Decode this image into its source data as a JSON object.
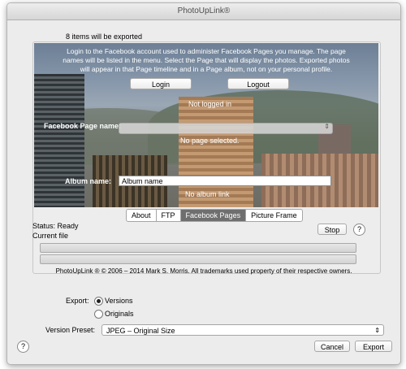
{
  "window": {
    "title": "PhotoUpLink®"
  },
  "export_info": {
    "items_count": "8 items will be exported"
  },
  "facebook": {
    "instructions": "Login to the Facebook account used to administer Facebook Pages you manage. The page names will be listed in the menu. Select the Page that will display the photos. Exported photos will appear in that Page timeline and in a Page album, not on your personal profile.",
    "login_label": "Login",
    "logout_label": "Logout",
    "login_status": "Not logged in",
    "page_label": "Facebook Page name:",
    "page_status": "No page selected.",
    "album_label": "Album name:",
    "album_value": "Album name",
    "album_link": "No album link"
  },
  "tabs": [
    {
      "label": "About"
    },
    {
      "label": "FTP"
    },
    {
      "label": "Facebook Pages",
      "active": true
    },
    {
      "label": "Picture Frame"
    }
  ],
  "status": {
    "status_text": "Status: Ready",
    "current_file": "Current file",
    "stop_label": "Stop",
    "help_label": "?"
  },
  "copyright": "PhotoUpLink ® © 2006 – 2014 Mark S. Morris. All trademarks used property of their respective owners.",
  "export": {
    "label": "Export:",
    "options": [
      {
        "label": "Versions",
        "selected": true
      },
      {
        "label": "Originals",
        "selected": false
      }
    ],
    "preset_label": "Version Preset:",
    "preset_value": "JPEG – Original Size"
  },
  "footer": {
    "help_label": "?",
    "cancel_label": "Cancel",
    "export_label": "Export"
  }
}
